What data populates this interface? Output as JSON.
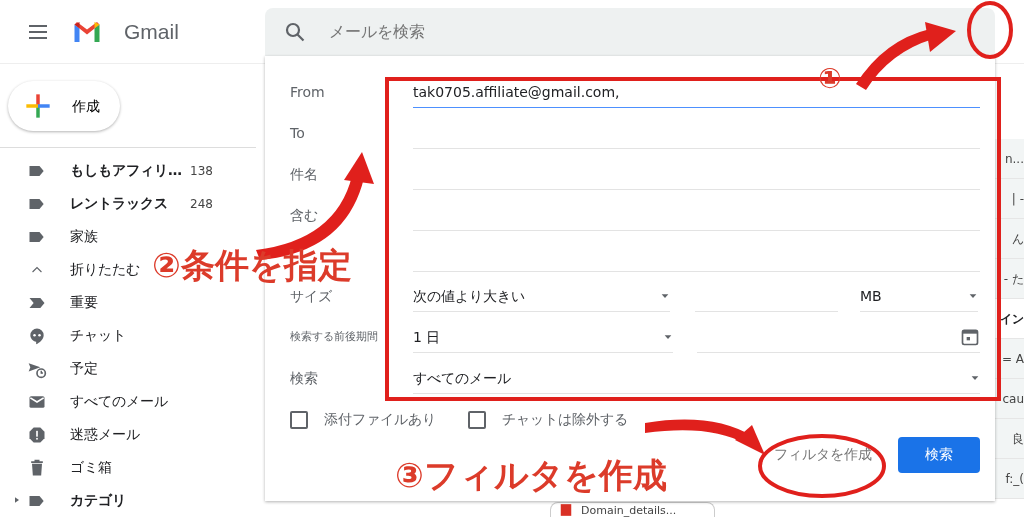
{
  "header": {
    "app_name": "Gmail",
    "search_placeholder": "メールを検索"
  },
  "compose": {
    "label": "作成"
  },
  "sidebar": {
    "items": [
      {
        "kind": "label",
        "label": "もしもアフィリ…",
        "count": "138",
        "unread": true,
        "expandable": false
      },
      {
        "kind": "label",
        "label": "レントラックス",
        "count": "248",
        "unread": true,
        "expandable": false
      },
      {
        "kind": "label",
        "label": "家族",
        "unread": false,
        "expandable": false
      },
      {
        "kind": "collapse",
        "label": "折りたたむ",
        "unread": false,
        "expandable": false
      },
      {
        "kind": "important",
        "label": "重要",
        "unread": false,
        "expandable": false
      },
      {
        "kind": "chat",
        "label": "チャット",
        "unread": false,
        "expandable": false
      },
      {
        "kind": "scheduled",
        "label": "予定",
        "unread": false,
        "expandable": false
      },
      {
        "kind": "mail",
        "label": "すべてのメール",
        "unread": false,
        "expandable": false
      },
      {
        "kind": "spam",
        "label": "迷惑メール",
        "unread": false,
        "expandable": false
      },
      {
        "kind": "trash",
        "label": "ゴミ箱",
        "unread": false,
        "expandable": false
      },
      {
        "kind": "label",
        "label": "カテゴリ",
        "unread": true,
        "expandable": true
      }
    ]
  },
  "mail_list": {
    "rows": [
      {
        "text": "n...",
        "unread": false
      },
      {
        "text": "| -",
        "unread": false
      },
      {
        "text": "ん",
        "unread": false
      },
      {
        "text": "- た",
        "unread": false
      },
      {
        "text": "イン",
        "unread": true
      },
      {
        "text": "= A",
        "unread": false
      },
      {
        "text": "cau",
        "unread": false
      },
      {
        "text": "良",
        "unread": false
      },
      {
        "text": "f:_(",
        "unread": false
      }
    ],
    "attachment": "Domain_details..."
  },
  "filter": {
    "fields": [
      {
        "label": "From",
        "value": "tak0705.affiliate@gmail.com,",
        "focused": true
      },
      {
        "label": "To",
        "focused": false
      },
      {
        "label": "件名",
        "focused": false
      },
      {
        "label": "含む",
        "focused": false
      },
      {
        "focused": false
      }
    ],
    "size": {
      "label": "サイズ",
      "operator": "次の値より大きい",
      "unit": "MB"
    },
    "date_range": {
      "label": "検索する前後期間",
      "value": "1 日"
    },
    "scope": {
      "label": "検索",
      "value": "すべてのメール"
    },
    "checkboxes": [
      {
        "label": "添付ファイルあり",
        "checked": false
      },
      {
        "label": "チャットは除外する",
        "checked": false
      }
    ],
    "create_filter": "フィルタを作成",
    "search_button": "検索"
  },
  "annotations": {
    "step_1": "①",
    "step_2": "②条件を指定",
    "step_3": "③フィルタを作成"
  }
}
